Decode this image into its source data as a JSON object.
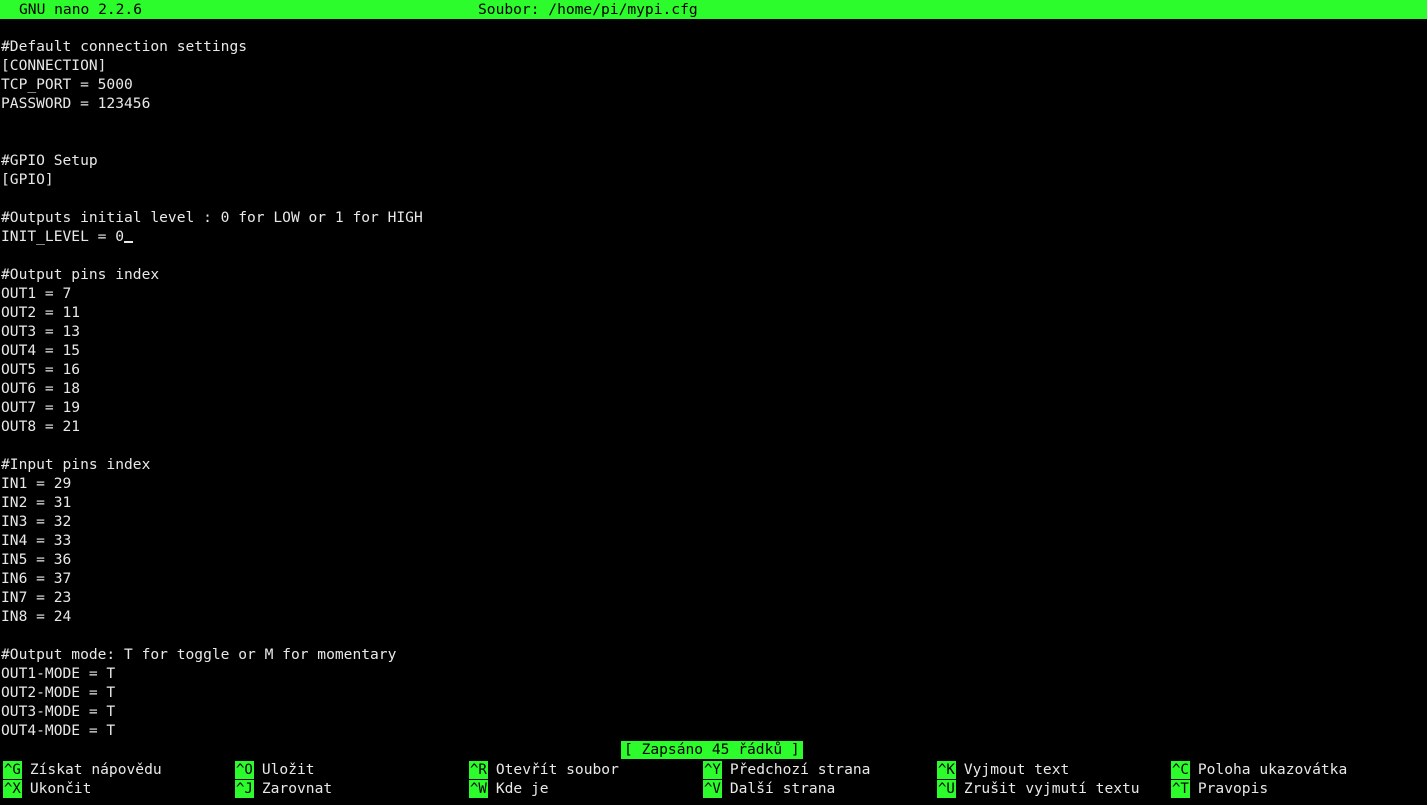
{
  "title_bar": {
    "app_name": "GNU nano 2.2.6",
    "file_name": "Soubor: /home/pi/mypi.cfg"
  },
  "editor": {
    "lines": [
      "#Default connection settings",
      "[CONNECTION]",
      "TCP_PORT = 5000",
      "PASSWORD = 123456",
      "",
      "",
      "#GPIO Setup",
      "[GPIO]",
      "",
      "#Outputs initial level : 0 for LOW or 1 for HIGH",
      "INIT_LEVEL = 0",
      "",
      "#Output pins index",
      "OUT1 = 7",
      "OUT2 = 11",
      "OUT3 = 13",
      "OUT4 = 15",
      "OUT5 = 16",
      "OUT6 = 18",
      "OUT7 = 19",
      "OUT8 = 21",
      "",
      "#Input pins index",
      "IN1 = 29",
      "IN2 = 31",
      "IN3 = 32",
      "IN4 = 33",
      "IN5 = 36",
      "IN6 = 37",
      "IN7 = 23",
      "IN8 = 24",
      "",
      "#Output mode: T for toggle or M for momentary",
      "OUT1-MODE = T",
      "OUT2-MODE = T",
      "OUT3-MODE = T",
      "OUT4-MODE = T"
    ],
    "cursor_line_index": 10
  },
  "status_message": "[ Zapsáno 45 řádků ]",
  "shortcuts": {
    "row1": [
      {
        "key": "^G",
        "label": "Získat nápovědu"
      },
      {
        "key": "^O",
        "label": "Uložit"
      },
      {
        "key": "^R",
        "label": "Otevřít soubor"
      },
      {
        "key": "^Y",
        "label": "Předchozí strana"
      },
      {
        "key": "^K",
        "label": "Vyjmout text"
      },
      {
        "key": "^C",
        "label": "Poloha ukazovátka"
      }
    ],
    "row2": [
      {
        "key": "^X",
        "label": "Ukončit"
      },
      {
        "key": "^J",
        "label": "Zarovnat"
      },
      {
        "key": "^W",
        "label": "Kde je"
      },
      {
        "key": "^V",
        "label": "Další strana"
      },
      {
        "key": "^U",
        "label": "Zrušit vyjmutí textu"
      },
      {
        "key": "^T",
        "label": "Pravopis"
      }
    ]
  },
  "colors": {
    "accent_green": "#2cfb2c",
    "background": "#000000",
    "text": "#e8e8e8"
  }
}
